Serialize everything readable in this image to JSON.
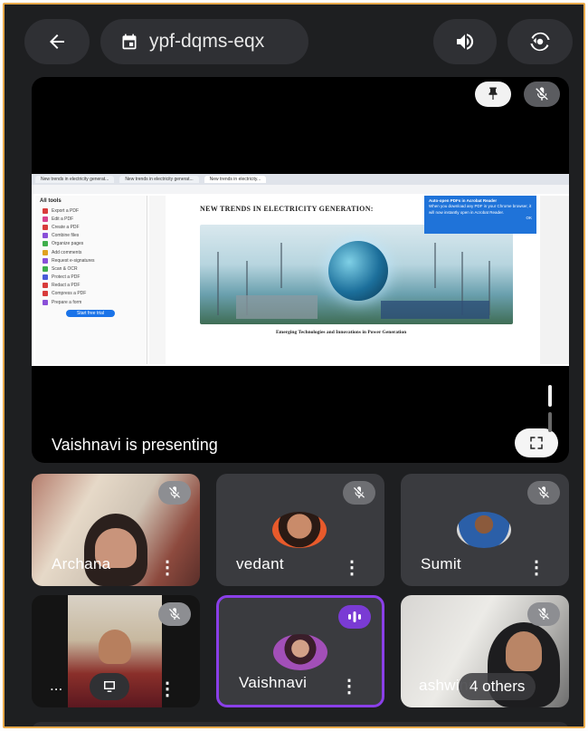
{
  "header": {
    "meeting_code": "ypf-dqms-eqx",
    "back_icon": "arrow-left-icon",
    "calendar_icon": "calendar-icon",
    "speaker_icon": "volume-icon",
    "switch_camera_icon": "camera-flip-icon"
  },
  "stage": {
    "presenter_text": "Vaishnavi is presenting",
    "shared_screen": {
      "tabs": [
        "New trends in electricity generat...",
        "New trends in electricity generat...",
        "New trends in electricity..."
      ],
      "tools_title": "All tools",
      "tools": [
        "Export a PDF",
        "Edit a PDF",
        "Create a PDF",
        "Combine files",
        "Organize pages",
        "Add comments",
        "Request e-signatures",
        "Scan & OCR",
        "Protect a PDF",
        "Redact a PDF",
        "Compress a PDF",
        "Prepare a form"
      ],
      "tools_button": "Start free trial",
      "doc_title": "NEW TRENDS IN ELECTRICITY GENERATION:",
      "doc_caption": "Emerging Technologies and Innovations in Power Generation",
      "popup_title": "Auto-open PDFs in Acrobat Reader",
      "popup_text": "When you download any PDF in your Chrome browser, it will now instantly open in Acrobat Reader.",
      "popup_action": "OK"
    }
  },
  "participants": [
    {
      "name": "Archana",
      "muted": true
    },
    {
      "name": "vedant",
      "muted": true
    },
    {
      "name": "Sumit",
      "muted": true
    },
    {
      "name": "...",
      "muted": true
    },
    {
      "name": "Vaishnavi",
      "speaking": true
    },
    {
      "name": "ashwini",
      "overlay": "4 others",
      "muted": true
    }
  ],
  "colors": {
    "background": "#1e1f21",
    "tile": "#3a3b3f",
    "accent_speaking": "#8a3fe8"
  }
}
